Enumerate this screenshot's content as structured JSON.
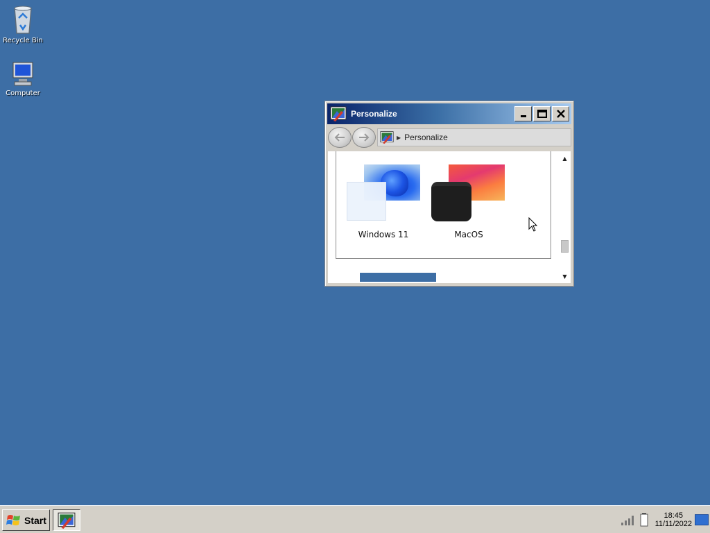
{
  "desktop": {
    "icons": [
      {
        "label": "Recycle Bin",
        "icon": "recycle-bin-icon"
      },
      {
        "label": "Computer",
        "icon": "computer-icon"
      }
    ],
    "background_color": "#3d6ea5"
  },
  "window": {
    "title": "Personalize",
    "icon": "personalize-icon",
    "controls": {
      "minimize": "minimize-icon",
      "maximize": "maximize-icon",
      "close": "close-icon"
    },
    "nav": {
      "back_icon": "back-arrow-icon",
      "forward_icon": "forward-arrow-icon"
    },
    "address": {
      "crumbs": [
        "Personalize"
      ]
    },
    "themes": [
      {
        "label": "Windows 11"
      },
      {
        "label": "MacOS"
      }
    ]
  },
  "taskbar": {
    "start_label": "Start",
    "task_buttons": [
      {
        "icon": "personalize-icon"
      }
    ],
    "tray": {
      "icons": [
        "signal-icon",
        "battery-icon"
      ],
      "time": "18:45",
      "date": "11/11/2022"
    }
  }
}
